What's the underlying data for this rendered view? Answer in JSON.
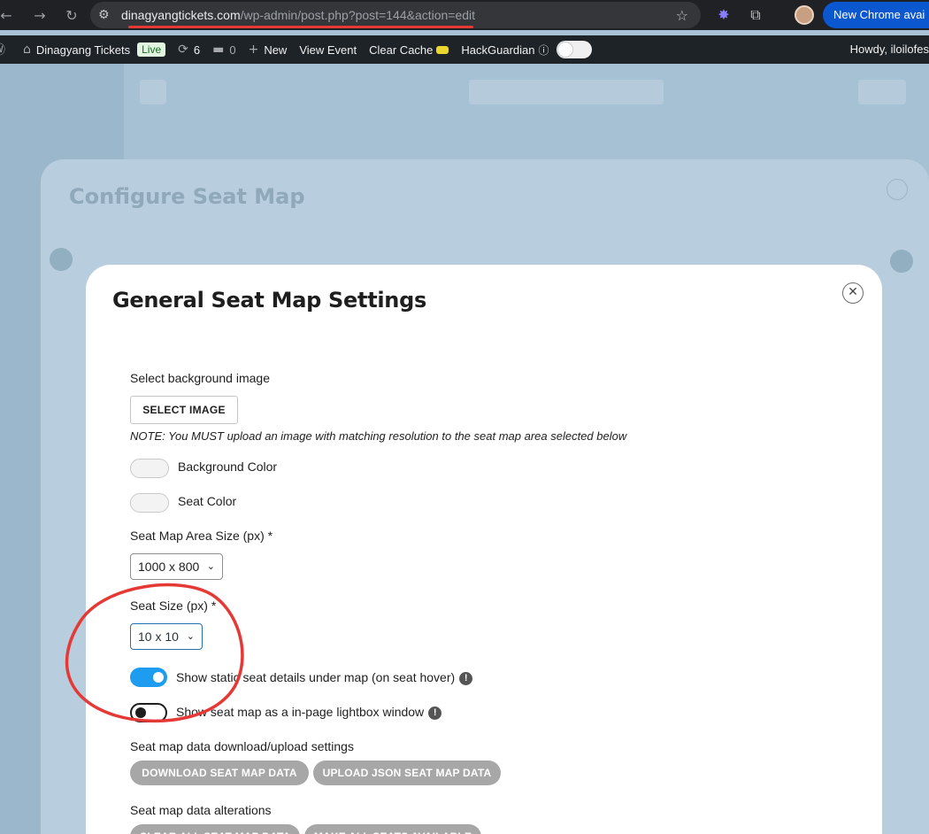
{
  "browser": {
    "url_host": "dinagyangtickets.com",
    "url_path": "/wp-admin/post.php?post=144&action=edit",
    "update_button": "New Chrome avai"
  },
  "admin_bar": {
    "site_name": "Dinagyang Tickets",
    "live_badge": "Live",
    "updates_count": "6",
    "comments_count": "0",
    "new_label": "New",
    "view_event": "View Event",
    "clear_cache": "Clear Cache",
    "hackguardian": "HackGuardian",
    "howdy": "Howdy, iloilofes"
  },
  "background": {
    "config_title": "Configure Seat Map"
  },
  "modal": {
    "title": "General Seat Map Settings",
    "bg_image_label": "Select background image",
    "select_image_button": "SELECT IMAGE",
    "note": "NOTE: You MUST upload an image with matching resolution to the seat map area selected below",
    "background_color_label": "Background Color",
    "seat_color_label": "Seat Color",
    "area_size_label": "Seat Map Area Size (px) *",
    "area_size_value": "1000 x 800",
    "seat_size_label": "Seat Size (px) *",
    "seat_size_value": "10 x 10",
    "static_details_label": "Show static seat details under map (on seat hover)",
    "lightbox_label": "Show seat map as a in-page lightbox window",
    "data_settings_label": "Seat map data download/upload settings",
    "download_button": "DOWNLOAD SEAT MAP DATA",
    "upload_button": "UPLOAD JSON SEAT MAP DATA",
    "alterations_label": "Seat map data alterations",
    "clear_button": "CLEAR ALL SEAT MAP DATA",
    "available_button": "MAKE ALL SEATS AVAILABLE",
    "static_details_enabled": true,
    "lightbox_enabled": false
  },
  "colors": {
    "accent_blue": "#1e9cf0",
    "annotation_red": "#e53935",
    "wp_bar": "#1d2327",
    "chrome_bar": "#202124"
  }
}
